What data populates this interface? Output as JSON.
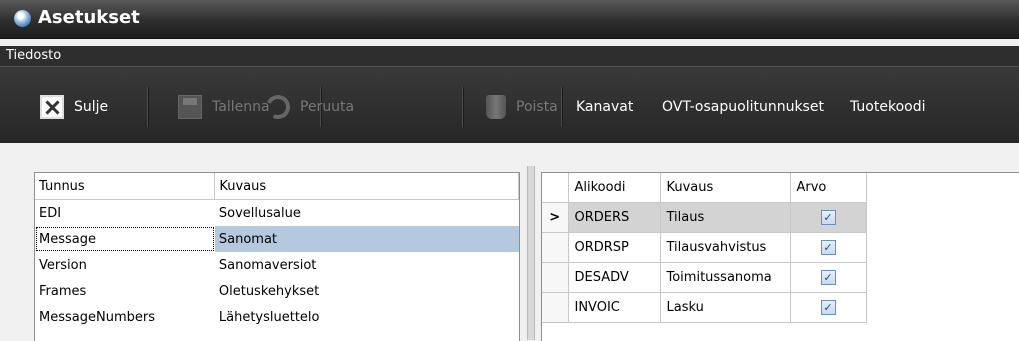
{
  "window": {
    "title": "Asetukset",
    "app_icon": "app-globe-icon"
  },
  "menu": {
    "file": "Tiedosto"
  },
  "toolbar": {
    "close": "Sulje",
    "save": "Tallenna",
    "undo": "Peruuta",
    "delete": "Poista",
    "channels": "Kanavat",
    "ovt": "OVT-osapuolitunnukset",
    "product_codes": "Tuotekoodi"
  },
  "left_table": {
    "columns": [
      "Tunnus",
      "Kuvaus"
    ],
    "rows": [
      [
        "EDI",
        "Sovellusalue"
      ],
      [
        "Message",
        "Sanomat"
      ],
      [
        "Version",
        "Sanomaversiot"
      ],
      [
        "Frames",
        "Oletuskehykset"
      ],
      [
        "MessageNumbers",
        "Lähetysluettelo"
      ]
    ],
    "selected_row": 1
  },
  "right_table": {
    "columns": [
      "Alikoodi",
      "Kuvaus",
      "Arvo"
    ],
    "current_marker": ">",
    "rows": [
      [
        "ORDERS",
        "Tilaus",
        "checked"
      ],
      [
        "ORDRSP",
        "Tilausvahvistus",
        "checked"
      ],
      [
        "DESADV",
        "Toimitussanoma",
        "checked"
      ],
      [
        "INVOIC",
        "Lasku",
        "checked"
      ]
    ],
    "current_row": 0
  }
}
